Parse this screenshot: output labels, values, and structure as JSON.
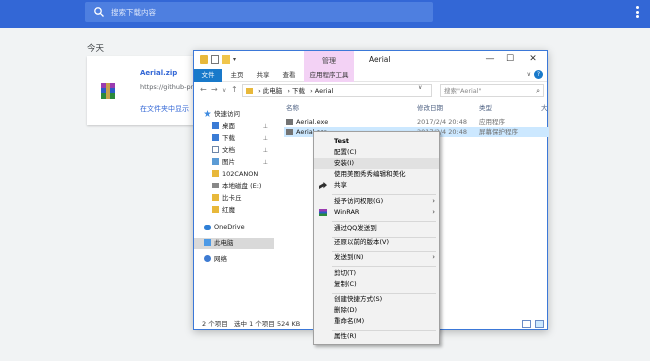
{
  "chrome": {
    "search_placeholder": "搜索下载内容",
    "section_label": "今天",
    "download": {
      "name": "Aerial.zip",
      "url": "https://github-prod",
      "show_in_folder": "在文件夹中显示"
    }
  },
  "window": {
    "title": "Aerial",
    "manage_tab": "管理",
    "qa_arrow": "▾",
    "controls": {
      "minimize": "—",
      "maximize": "☐",
      "close": "✕"
    },
    "ribbon_tabs": [
      "文件",
      "主页",
      "共享",
      "查看",
      "应用程序工具"
    ],
    "ribbon_expand": "∨",
    "help": "?",
    "nav": {
      "back": "←",
      "forward": "→",
      "up_menu": "∨",
      "up": "↑"
    },
    "address": [
      "此电脑",
      "下载",
      "Aerial"
    ],
    "address_sep": "›",
    "address_dropdown": "∨",
    "refresh": "↻",
    "search_placeholder": "搜索\"Aerial\"",
    "search_icon": "⌕",
    "sidebar": [
      {
        "label": "快速访问",
        "icon": "star"
      },
      {
        "label": "桌面",
        "icon": "blue",
        "pinned": true
      },
      {
        "label": "下载",
        "icon": "dl",
        "pinned": true
      },
      {
        "label": "文档",
        "icon": "doc",
        "pinned": true
      },
      {
        "label": "图片",
        "icon": "pic",
        "pinned": true
      },
      {
        "label": "102CANON",
        "icon": "fold"
      },
      {
        "label": "本地磁盘 (E:)",
        "icon": "drive"
      },
      {
        "label": "比卡丘",
        "icon": "fold"
      },
      {
        "label": "红魔",
        "icon": "fold"
      },
      {
        "label": "OneDrive",
        "icon": "cloud"
      },
      {
        "label": "此电脑",
        "icon": "pc",
        "selected": true
      },
      {
        "label": "网络",
        "icon": "net"
      }
    ],
    "pin_glyph": "⊥",
    "columns": {
      "name": "名称",
      "modified": "修改日期",
      "type": "类型",
      "size": "大"
    },
    "files": [
      {
        "name": "Aerial.exe",
        "modified": "2017/2/4 20:48",
        "type": "应用程序",
        "selected": false
      },
      {
        "name": "Aerial.scr",
        "modified": "2017/2/4 20:48",
        "type": "屏幕保护程序",
        "selected": true
      }
    ],
    "status": {
      "count": "2 个项目",
      "selection": "选中 1 个项目",
      "size": "524 KB"
    }
  },
  "context_menu": [
    {
      "label": "Test",
      "bold": true
    },
    {
      "label": "配置(C)"
    },
    {
      "label": "安装(I)",
      "highlighted": true
    },
    {
      "label": "使用美图秀秀编辑和美化"
    },
    {
      "label": "共享",
      "icon": "share"
    },
    {
      "separator": true
    },
    {
      "label": "授予访问权限(G)",
      "submenu": true
    },
    {
      "label": "WinRAR",
      "icon": "winrar",
      "submenu": true
    },
    {
      "separator": true
    },
    {
      "label": "通过QQ发送到"
    },
    {
      "separator": true
    },
    {
      "label": "还原以前的版本(V)"
    },
    {
      "separator": true
    },
    {
      "label": "发送到(N)",
      "submenu": true
    },
    {
      "separator": true
    },
    {
      "label": "剪切(T)"
    },
    {
      "label": "复制(C)"
    },
    {
      "separator": true
    },
    {
      "label": "创建快捷方式(S)"
    },
    {
      "label": "删除(D)"
    },
    {
      "label": "重命名(M)"
    },
    {
      "separator": true
    },
    {
      "label": "属性(R)"
    }
  ],
  "submenu_glyph": "›"
}
